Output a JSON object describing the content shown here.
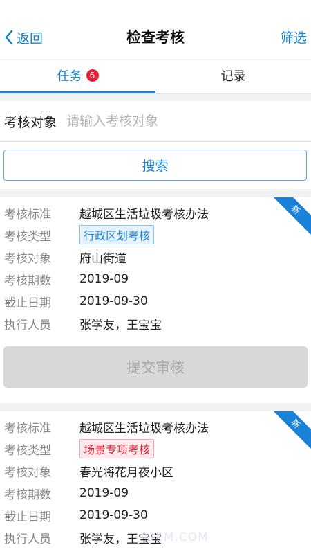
{
  "nav": {
    "back_label": "返回",
    "title": "检查考核",
    "filter_label": "筛选"
  },
  "tabs": {
    "task_label": "任务",
    "task_badge": "6",
    "record_label": "记录"
  },
  "search": {
    "label": "考核对象",
    "placeholder": "请输入考核对象",
    "value": "",
    "button_label": "搜索"
  },
  "field_labels": {
    "standard": "考核标准",
    "type": "考核类型",
    "target": "考核对象",
    "period": "考核期数",
    "deadline": "截止日期",
    "executor": "执行人员"
  },
  "cards": [
    {
      "ribbon": "新",
      "standard": "越城区生活垃圾考核办法",
      "type": "行政区划考核",
      "type_color": "#1a82d8",
      "target": "府山街道",
      "period": "2019-09",
      "deadline": "2019-09-30",
      "executor": "张学友，王宝宝",
      "submit_label": "提交审核"
    },
    {
      "ribbon": "新",
      "standard": "越城区生活垃圾考核办法",
      "type": "场景专项考核",
      "type_color": "#e8213a",
      "target": "春光将花月夜小区",
      "period": "2019-09",
      "deadline": "2019-09-30",
      "executor": "张学友，王宝宝"
    }
  ],
  "watermark": "GZM.COM",
  "colors": {
    "accent": "#1a82d8",
    "badge": "#e8213a",
    "disabled": "#d8d8d8"
  }
}
